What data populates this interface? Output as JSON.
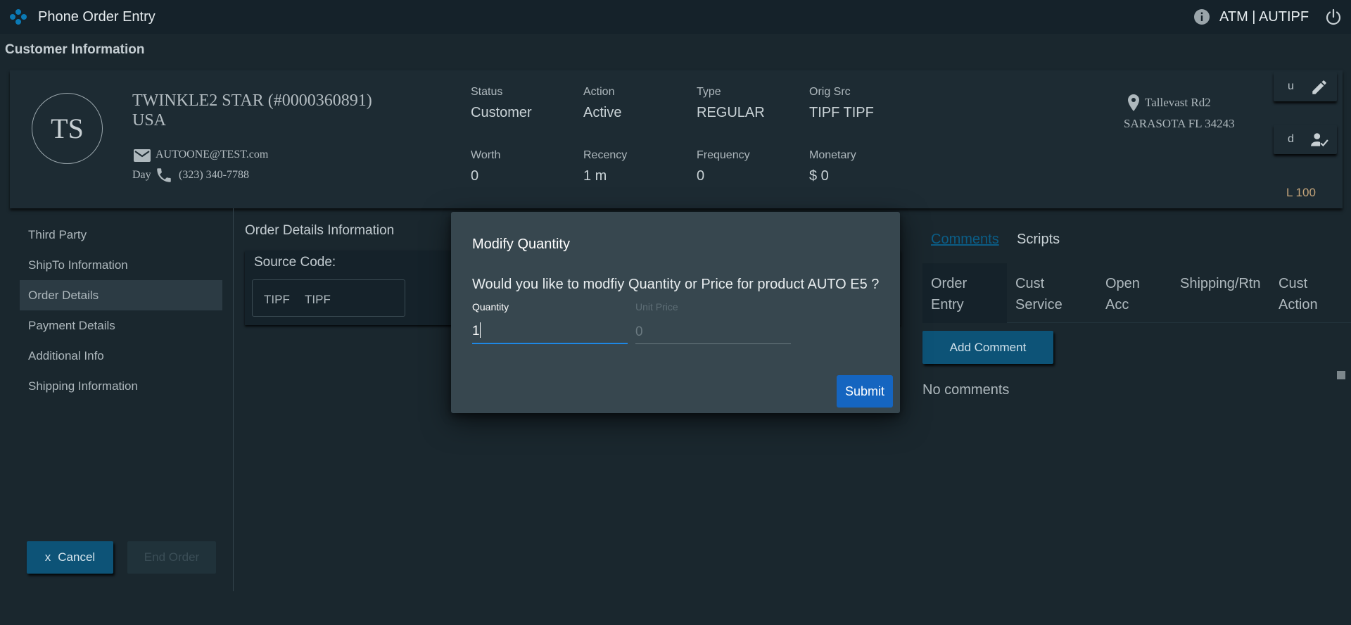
{
  "app": {
    "title": "Phone Order Entry",
    "user": "ATM | AUTIPF"
  },
  "section_title": "Customer Information",
  "customer": {
    "initials": "TS",
    "name": "TWINKLE2 STAR (#0000360891)",
    "country": "USA",
    "email": "AUTOONE@TEST.com",
    "day_label": "Day",
    "phone": "(323) 340-7788",
    "address_line1": "Tallevast Rd2",
    "address_line2": "SARASOTA FL 34243"
  },
  "stats": {
    "status": {
      "label": "Status",
      "value": "Customer"
    },
    "action": {
      "label": "Action",
      "value": "Active"
    },
    "type": {
      "label": "Type",
      "value": "REGULAR"
    },
    "orig_src": {
      "label": "Orig Src",
      "value": "TIPF TIPF"
    },
    "worth": {
      "label": "Worth",
      "value": "0"
    },
    "recency": {
      "label": "Recency",
      "value": "1 m"
    },
    "frequency": {
      "label": "Frequency",
      "value": "0"
    },
    "monetary": {
      "label": "Monetary",
      "value": "$ 0"
    }
  },
  "side_buttons": {
    "edit_label": "u",
    "verify_label": "d",
    "level": "L 100"
  },
  "nav": {
    "items": [
      {
        "label": "Third Party"
      },
      {
        "label": "ShipTo Information"
      },
      {
        "label": "Order Details"
      },
      {
        "label": "Payment Details"
      },
      {
        "label": "Additional Info"
      },
      {
        "label": "Shipping Information"
      }
    ],
    "active_index": 2,
    "cancel_x": "x",
    "cancel_label": "Cancel",
    "end_order_label": "End Order"
  },
  "order_details": {
    "title": "Order Details Information",
    "source_code_label": "Source Code:",
    "source_code_1": "TIPF",
    "source_code_2": "TIPF"
  },
  "right_panel": {
    "tabs": {
      "comments": "Comments",
      "scripts": "Scripts"
    },
    "subtabs": [
      {
        "line1": "Order",
        "line2": "Entry"
      },
      {
        "line1": "Cust",
        "line2": "Service"
      },
      {
        "line1": "Open",
        "line2": "Acc"
      },
      {
        "line1": "Shipping/Rtn",
        "line2": ""
      },
      {
        "line1": "Cust",
        "line2": "Action"
      }
    ],
    "add_comment_label": "Add Comment",
    "no_comments": "No comments"
  },
  "modal": {
    "title": "Modify Quantity",
    "message": "Would you like to modfiy Quantity or Price for product AUTO E5 ?",
    "quantity_label": "Quantity",
    "quantity_value": "1",
    "unit_price_label": "Unit Price",
    "unit_price_value": "0",
    "submit_label": "Submit"
  },
  "colors": {
    "background": "#1a272e",
    "topbar": "#15222a",
    "primary_button": "#0d5377",
    "submit_button": "#1565c0",
    "input_focus": "#1e88e5",
    "modal_bg": "#37474f",
    "level_text": "#c4a47a"
  }
}
